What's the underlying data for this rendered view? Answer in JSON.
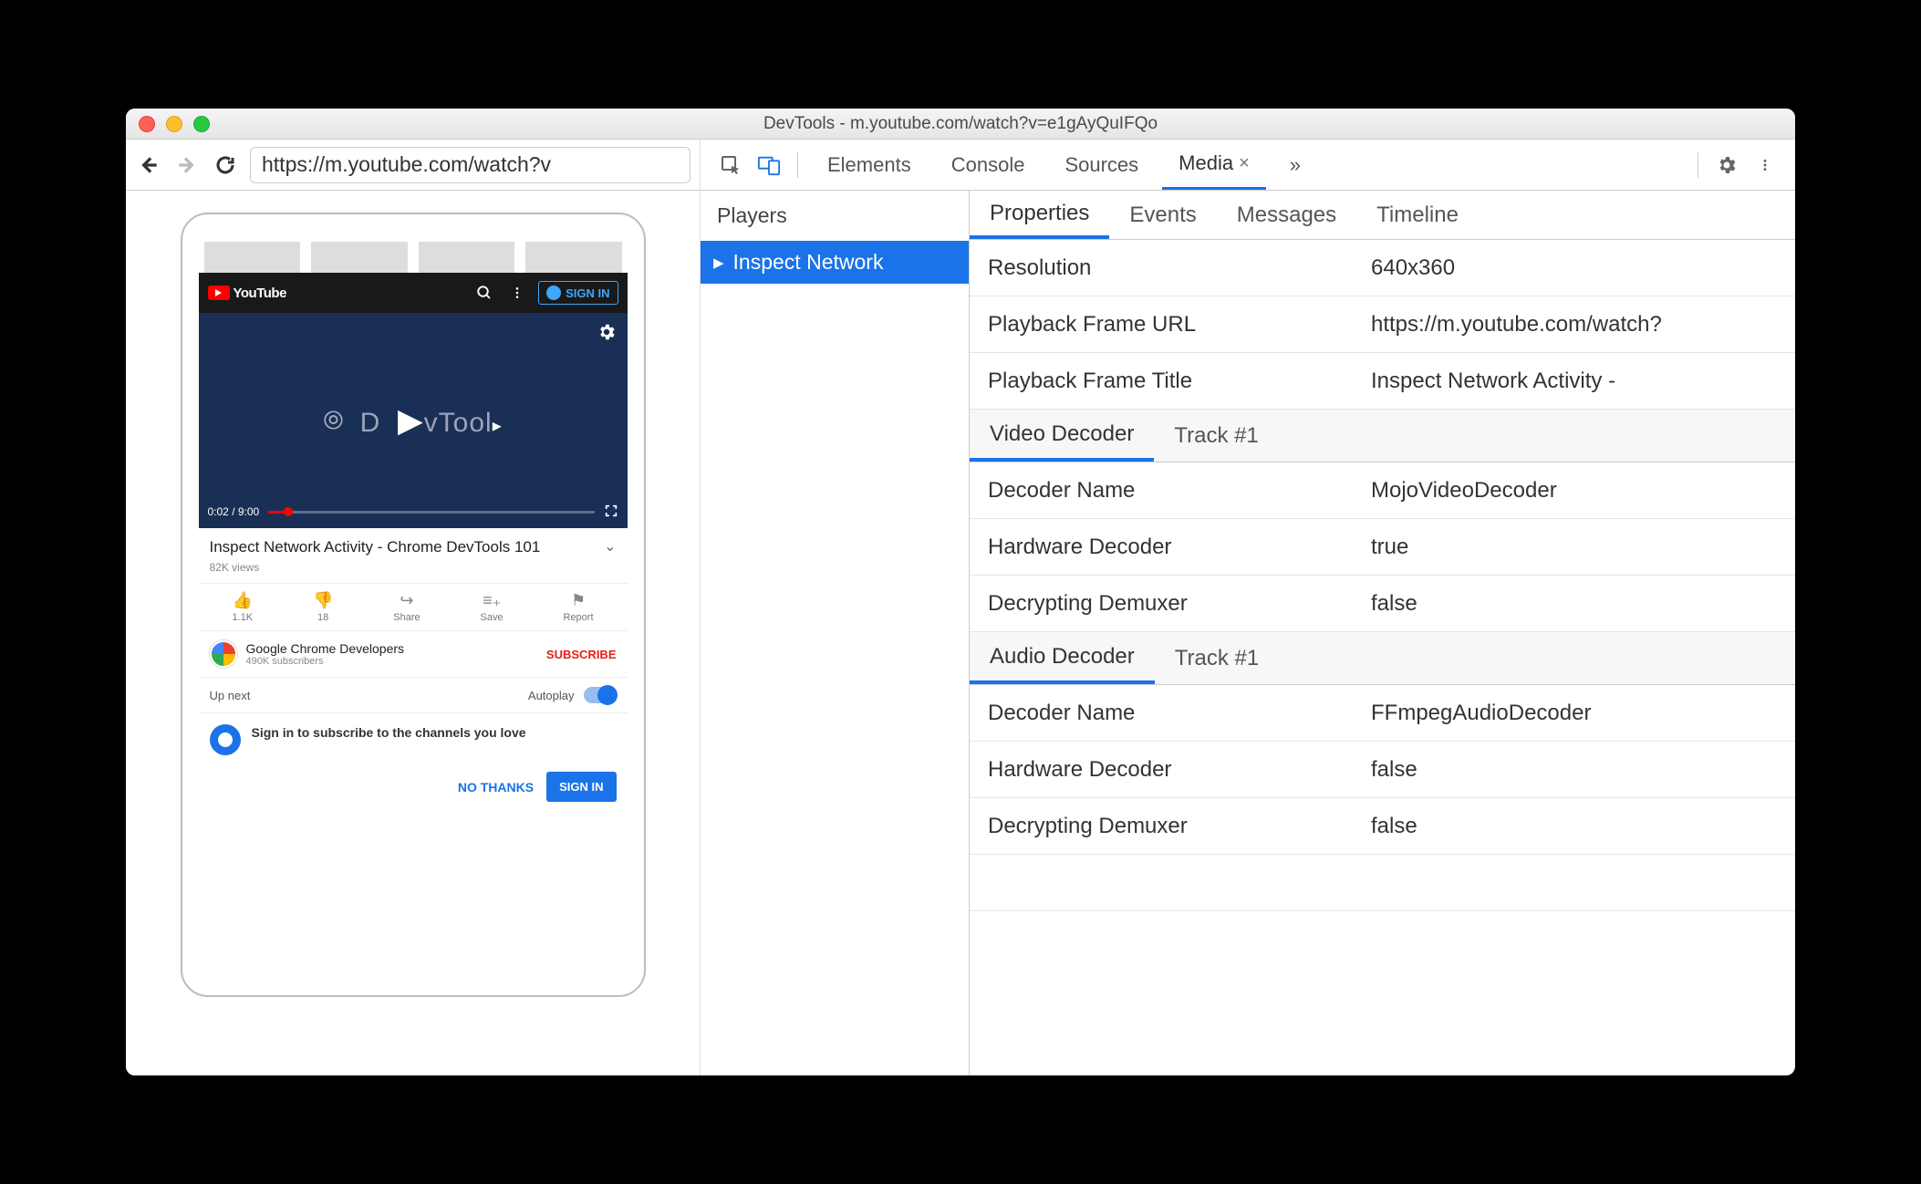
{
  "window": {
    "title": "DevTools - m.youtube.com/watch?v=e1gAyQuIFQo"
  },
  "browser": {
    "url": "https://m.youtube.com/watch?v"
  },
  "youtube": {
    "logo_text": "YouTube",
    "signin": "SIGN IN",
    "player": {
      "brand": "D   vTool",
      "time": "0:02 / 9:00"
    },
    "video": {
      "title": "Inspect Network Activity - Chrome DevTools 101",
      "views": "82K views"
    },
    "actions": {
      "like": {
        "count": "1.1K"
      },
      "dislike": {
        "count": "18"
      },
      "share": {
        "label": "Share"
      },
      "save": {
        "label": "Save"
      },
      "report": {
        "label": "Report"
      }
    },
    "channel": {
      "name": "Google Chrome Developers",
      "subs": "490K subscribers",
      "subscribe": "SUBSCRIBE"
    },
    "upnext": {
      "label": "Up next",
      "autoplay": "Autoplay"
    },
    "promo": {
      "msg": "Sign in to subscribe to the channels you love",
      "no": "NO THANKS",
      "yes": "SIGN IN"
    }
  },
  "devtools": {
    "tabs": {
      "elements": "Elements",
      "console": "Console",
      "sources": "Sources",
      "media": "Media"
    },
    "players_header": "Players",
    "player_item": "Inspect Network",
    "subtabs": {
      "properties": "Properties",
      "events": "Events",
      "messages": "Messages",
      "timeline": "Timeline"
    },
    "props": {
      "resolution": {
        "k": "Resolution",
        "v": "640x360"
      },
      "frame_url": {
        "k": "Playback Frame URL",
        "v": "https://m.youtube.com/watch?"
      },
      "frame_title": {
        "k": "Playback Frame Title",
        "v": "Inspect Network Activity -"
      }
    },
    "video_decoder": {
      "section": "Video Decoder",
      "track": "Track #1",
      "name": {
        "k": "Decoder Name",
        "v": "MojoVideoDecoder"
      },
      "hw": {
        "k": "Hardware Decoder",
        "v": "true"
      },
      "demux": {
        "k": "Decrypting Demuxer",
        "v": "false"
      }
    },
    "audio_decoder": {
      "section": "Audio Decoder",
      "track": "Track #1",
      "name": {
        "k": "Decoder Name",
        "v": "FFmpegAudioDecoder"
      },
      "hw": {
        "k": "Hardware Decoder",
        "v": "false"
      },
      "demux": {
        "k": "Decrypting Demuxer",
        "v": "false"
      }
    }
  }
}
